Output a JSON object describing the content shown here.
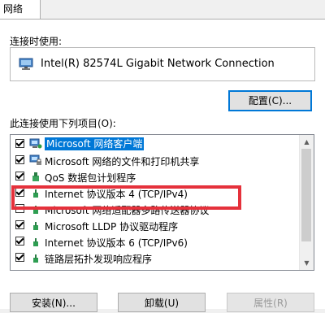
{
  "tab": {
    "label": "网络"
  },
  "connect_using": {
    "label": "连接时使用:",
    "adapter": "Intel(R) 82574L Gigabit Network Connection"
  },
  "configure_button": "配置(C)...",
  "items_label": "此连接使用下列项目(O):",
  "items": [
    {
      "label": "Microsoft 网络客户端",
      "checked": true,
      "icon": "network-client-icon",
      "selected": true
    },
    {
      "label": "Microsoft 网络的文件和打印机共享",
      "checked": true,
      "icon": "file-print-sharing-icon",
      "selected": false
    },
    {
      "label": "QoS 数据包计划程序",
      "checked": true,
      "icon": "qos-icon",
      "selected": false
    },
    {
      "label": "Internet 协议版本 4 (TCP/IPv4)",
      "checked": true,
      "icon": "protocol-icon",
      "selected": false
    },
    {
      "label": "Microsoft 网络适配器多路传送器协议",
      "checked": false,
      "icon": "protocol-icon",
      "selected": false
    },
    {
      "label": "Microsoft LLDP 协议驱动程序",
      "checked": true,
      "icon": "protocol-icon",
      "selected": false
    },
    {
      "label": "Internet 协议版本 6 (TCP/IPv6)",
      "checked": true,
      "icon": "protocol-icon",
      "selected": false
    },
    {
      "label": "链路层拓扑发现响应程序",
      "checked": true,
      "icon": "protocol-icon",
      "selected": false
    }
  ],
  "buttons": {
    "install": "安装(N)...",
    "uninstall": "卸载(U)",
    "properties": "属性(R)"
  },
  "colors": {
    "highlight": "#e5313b",
    "selection": "#0078d7"
  }
}
